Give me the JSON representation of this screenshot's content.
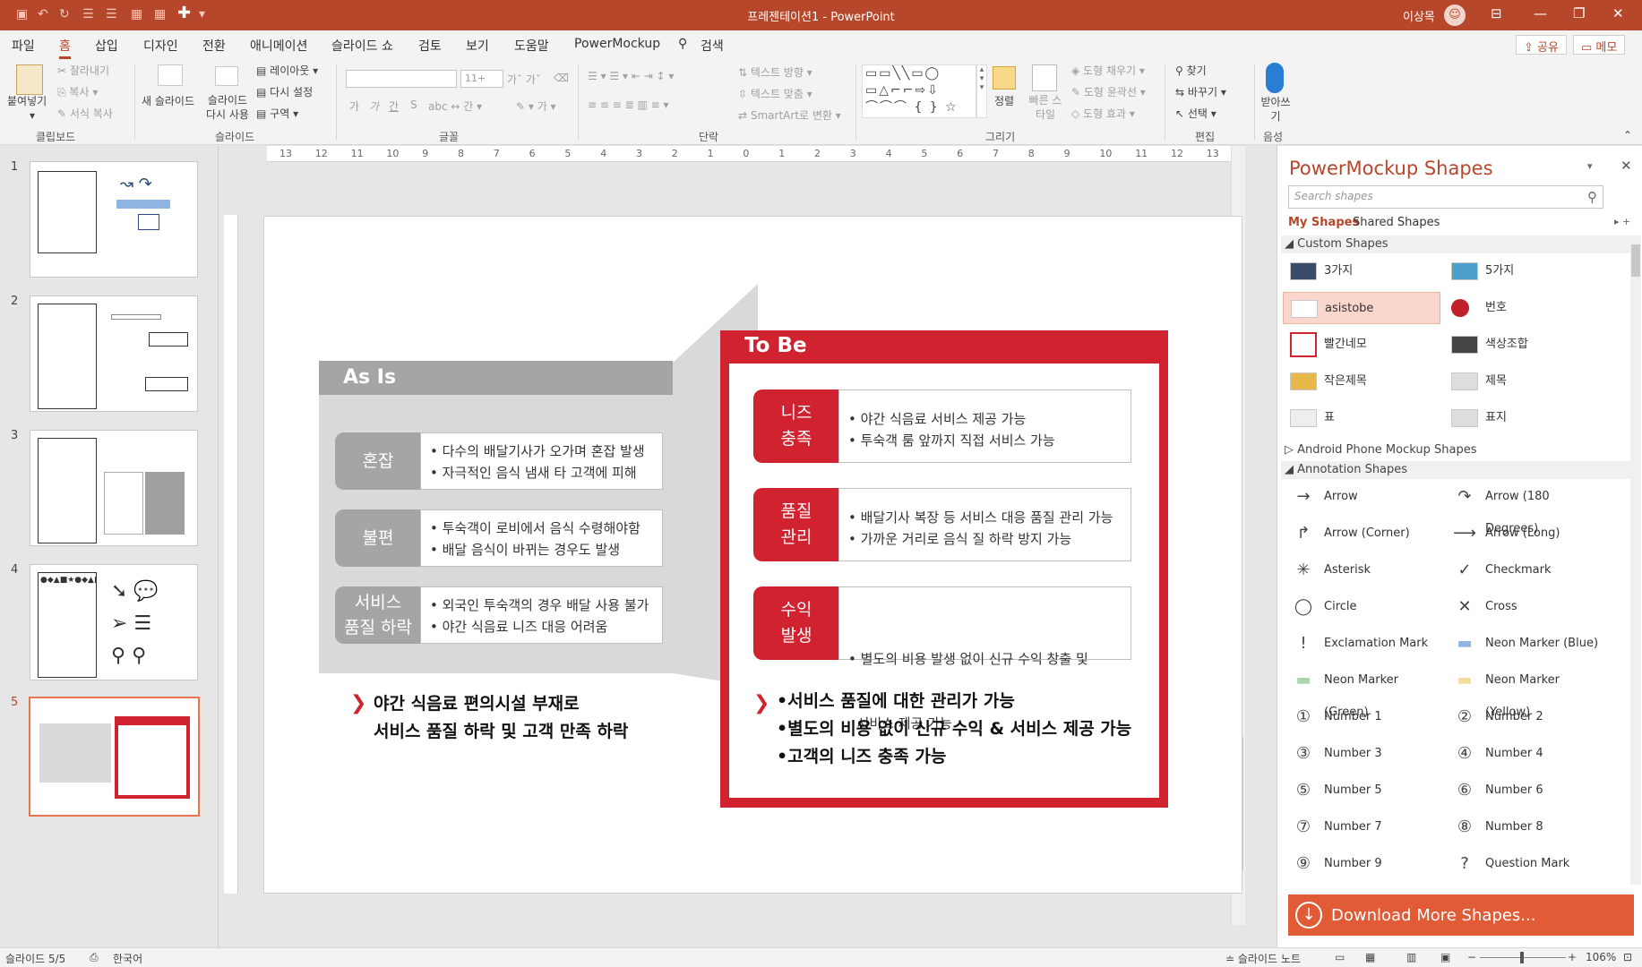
{
  "window": {
    "title": "프레젠테이션1  -  PowerPoint",
    "user": "이상목",
    "minimize_label": "—",
    "restore_label": "❐",
    "close_label": "✕"
  },
  "menu": {
    "items": [
      "파일",
      "홈",
      "삽입",
      "디자인",
      "전환",
      "애니메이션",
      "슬라이드 쇼",
      "검토",
      "보기",
      "도움말",
      "PowerMockup"
    ],
    "search": "검색",
    "share": "공유",
    "comment": "메모"
  },
  "ribbon": {
    "clipboard": {
      "paste": "붙여넣기",
      "cut": "잘라내기",
      "copy": "복사",
      "format_painter": "서식 복사",
      "label": "클립보드"
    },
    "slides": {
      "new_slide": "새 슬라이드",
      "reuse": "슬라이드 다시 사용",
      "layout": "레이아웃",
      "reset": "다시 설정",
      "section": "구역",
      "label": "슬라이드"
    },
    "font": {
      "label": "글꼴",
      "size": "11+",
      "bold": "가",
      "italic": "가",
      "underline": "간",
      "strike": "S"
    },
    "paragraph": {
      "label": "단락",
      "text_direction": "텍스트 방향",
      "align_text": "텍스트 맞춤",
      "smartart": "SmartArt로 변환"
    },
    "drawing": {
      "label": "그리기",
      "arrange": "정렬",
      "quick_styles": "빠른 스타일",
      "fill": "도형 채우기",
      "outline": "도형 윤곽선",
      "effects": "도형 효과"
    },
    "editing": {
      "label": "편집",
      "find": "찾기",
      "replace": "바꾸기",
      "select": "선택"
    },
    "voice": {
      "label": "음성",
      "dictate": "받아쓰기"
    }
  },
  "thumbnails": {
    "numbers": [
      "1",
      "2",
      "3",
      "4",
      "5"
    ],
    "selected": "5"
  },
  "ruler": {
    "h_ticks": [
      "13",
      "12",
      "11",
      "10",
      "9",
      "8",
      "7",
      "6",
      "5",
      "4",
      "3",
      "2",
      "1",
      "0",
      "1",
      "2",
      "3",
      "4",
      "5",
      "6",
      "7",
      "8",
      "9",
      "10",
      "11",
      "12",
      "13"
    ]
  },
  "slide": {
    "asis": {
      "title": "As Is",
      "rows": [
        {
          "label": "혼잡",
          "lines": [
            "• 다수의 배달기사가 오가며 혼잡 발생",
            "• 자극적인 음식 냄새 타 고객에 피해"
          ]
        },
        {
          "label": "불편",
          "lines": [
            "• 투숙객이 로비에서 음식 수령해야함",
            "• 배달 음식이 바뀌는 경우도 발생"
          ]
        },
        {
          "label": "서비스\n품질 하락",
          "lines": [
            "• 외국인 투숙객의 경우 배달 사용 불가",
            "• 야간 식음료 니즈 대응 어려움"
          ]
        }
      ],
      "summary": [
        "야간 식음료 편의시설 부재로",
        "서비스 품질 하락 및 고객 만족 하락"
      ]
    },
    "tobe": {
      "title": "To Be",
      "rows": [
        {
          "label": "니즈\n충족",
          "lines": [
            "• 야간 식음료 서비스 제공 가능",
            "• 투숙객 룸 앞까지 직접 서비스 가능"
          ]
        },
        {
          "label": "품질\n관리",
          "lines": [
            "• 배달기사 복장 등 서비스 대응 품질 관리 가능",
            "• 가까운 거리로 음식 질 하락 방지 가능"
          ]
        },
        {
          "label": "수익\n발생",
          "lines": [
            "• 별도의 비용 발생 없이 신규 수익 창출 및",
            "  서비스 제공 가능"
          ]
        }
      ],
      "summary": [
        "•서비스 품질에 대한 관리가 가능",
        "•별도의 비용 없이 신규 수익 & 서비스 제공 가능",
        "•고객의 니즈 충족 가능"
      ]
    }
  },
  "panel": {
    "title": "PowerMockup Shapes",
    "search_placeholder": "Search shapes",
    "tabs": [
      "My Shapes",
      "Shared Shapes"
    ],
    "sections": {
      "custom": "Custom Shapes",
      "android": "Android Phone Mockup Shapes",
      "annotation": "Annotation Shapes"
    },
    "custom_shapes": [
      "3가지",
      "5가지",
      "asistobe",
      "번호",
      "빨간네모",
      "색상조합",
      "작은제목",
      "제목",
      "표",
      "표지"
    ],
    "annotation_shapes": [
      "Arrow",
      "Arrow (180 Degrees)",
      "Arrow (Corner)",
      "Arrow (Long)",
      "Asterisk",
      "Checkmark",
      "Circle",
      "Cross",
      "Exclamation Mark",
      "Neon Marker (Blue)",
      "Neon Marker (Green)",
      "Neon Marker (Yellow)",
      "Number 1",
      "Number 2",
      "Number 3",
      "Number 4",
      "Number 5",
      "Number 6",
      "Number 7",
      "Number 8",
      "Number 9",
      "Question Mark"
    ],
    "download": "Download More Shapes..."
  },
  "status": {
    "slide_pos": "슬라이드 5/5",
    "language": "한국어",
    "notes": "슬라이드 노트",
    "zoom": "106%"
  },
  "colors": {
    "accent": "#b7472a",
    "slide_red": "#d0222f",
    "asis_gray": "#a5a5a7"
  }
}
